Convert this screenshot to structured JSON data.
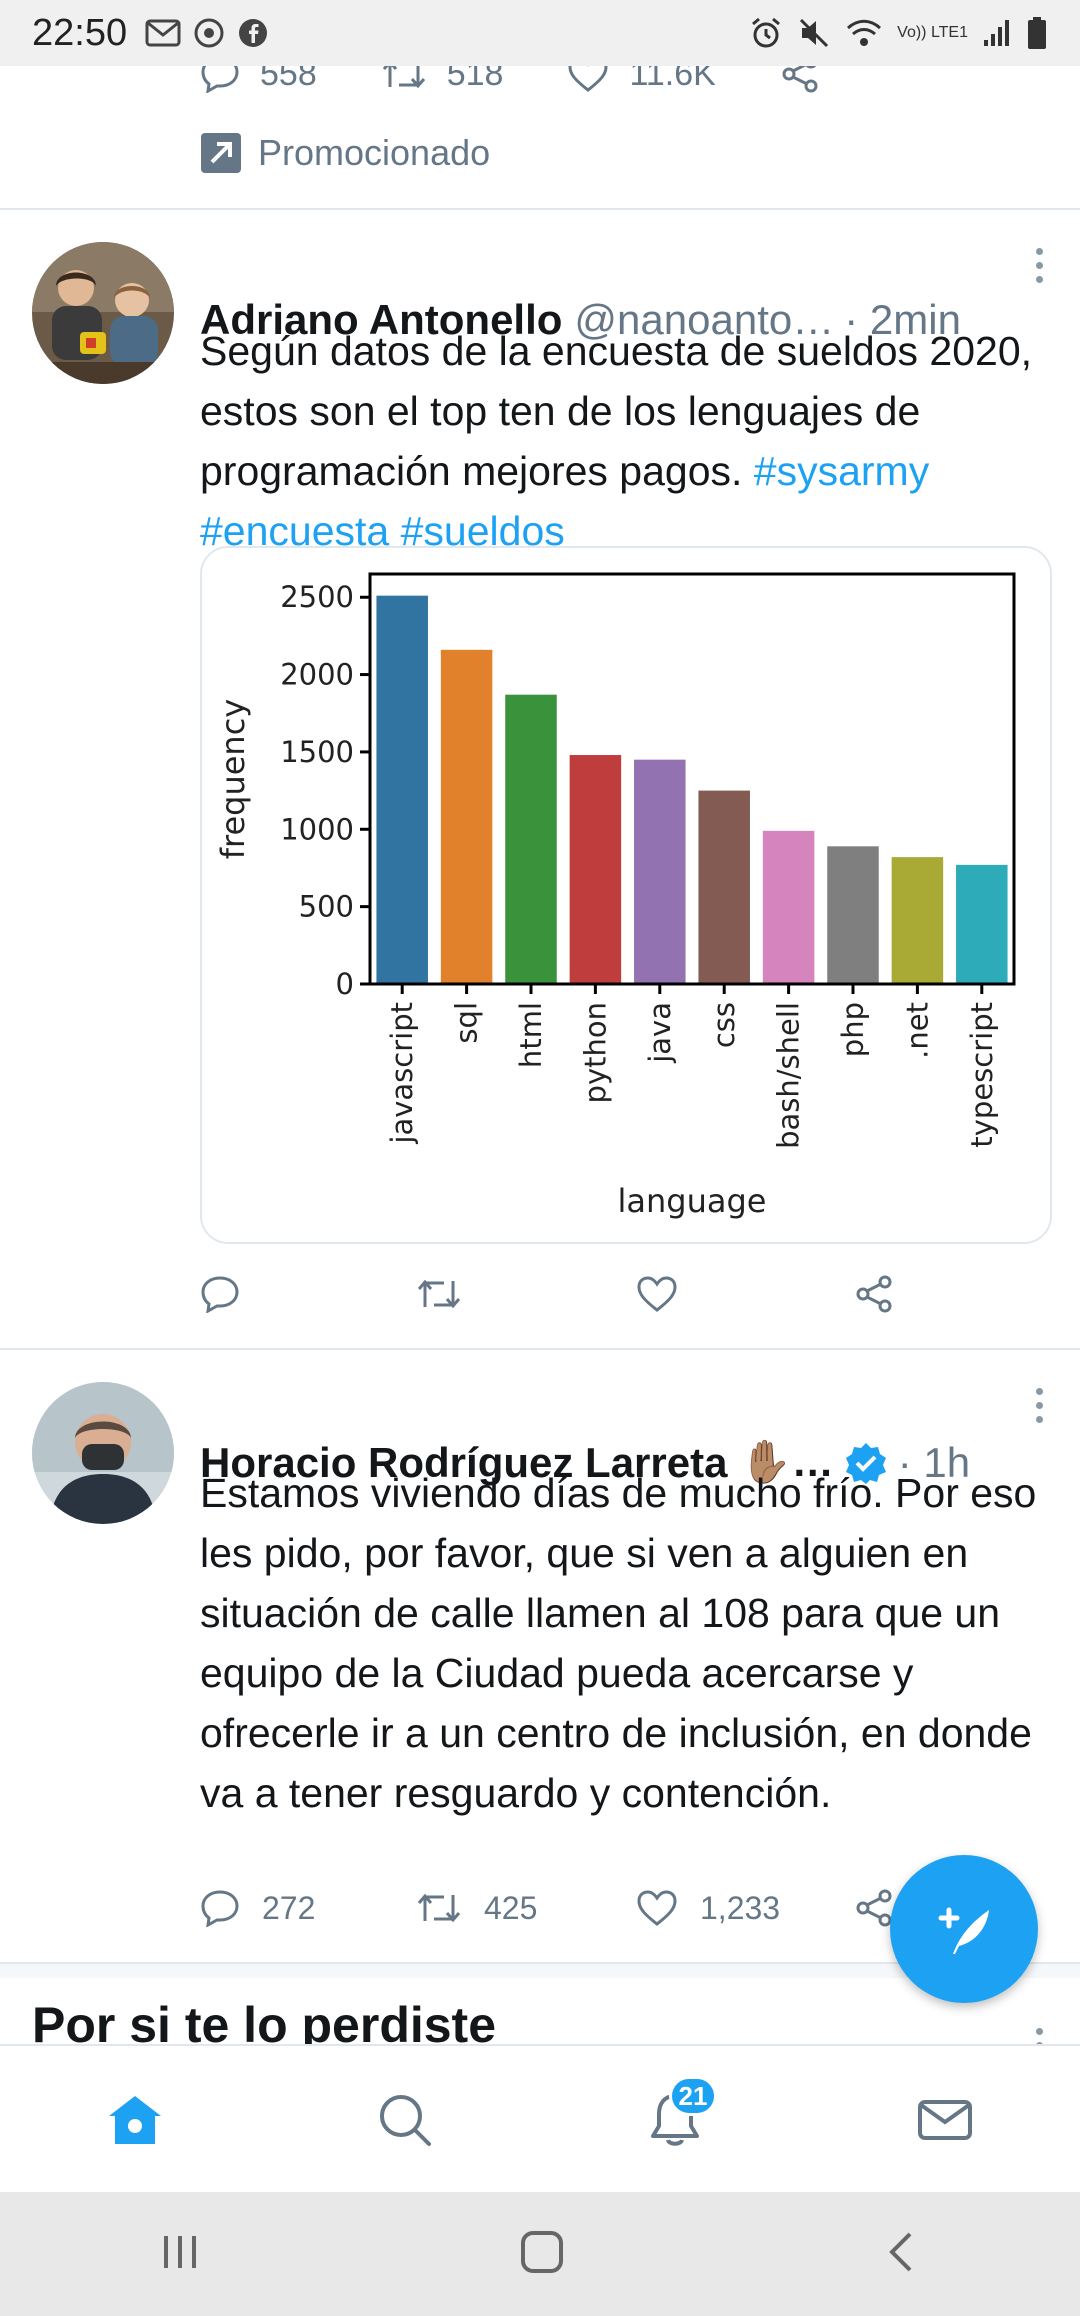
{
  "status_bar": {
    "time": "22:50",
    "network": "Vo)) LTE1"
  },
  "previous_tweet": {
    "replies": "558",
    "retweets": "518",
    "likes": "11.6K",
    "promoted_label": "Promocionado"
  },
  "tweets": [
    {
      "name": "Adriano Antonello",
      "handle": "@nanoanto…",
      "time": "· 2min",
      "text": "Según datos de la encuesta de sueldos 2020, estos son el top ten de los lenguajes de programación mejores pagos.",
      "hashtags": [
        "#sysarmy",
        "#encuesta",
        "#sueldos"
      ]
    },
    {
      "name": "Horacio Rodríguez Larreta",
      "emoji": "✋🏽…",
      "time": "· 1h",
      "text": "Estamos viviendo días de mucho frío. Por eso les pido, por favor, que si ven a alguien en situación de calle llamen al 108 para que un equipo de la Ciudad pueda acercarse y ofrecerle ir a un centro de inclusión, en donde va a tener resguardo y contención.",
      "replies": "272",
      "retweets": "425",
      "likes": "1,233"
    }
  ],
  "section_title": "Por si te lo perdiste",
  "bottom_nav": {
    "notifications_badge": "21"
  },
  "chart_data": {
    "type": "bar",
    "categories": [
      "javascript",
      "sql",
      "html",
      "python",
      "java",
      "css",
      "bash/shell",
      "php",
      ".net",
      "typescript"
    ],
    "values": [
      2510,
      2160,
      1870,
      1480,
      1450,
      1250,
      990,
      890,
      820,
      770
    ],
    "colors": [
      "#3274a1",
      "#e1812c",
      "#3a923a",
      "#c03d3e",
      "#9372b2",
      "#845b53",
      "#d684bd",
      "#7f7f7f",
      "#a9aa35",
      "#2eabb8"
    ],
    "xlabel": "language",
    "ylabel": "frequency",
    "yticks": [
      0,
      500,
      1000,
      1500,
      2000,
      2500
    ],
    "ylim": [
      0,
      2650
    ]
  }
}
